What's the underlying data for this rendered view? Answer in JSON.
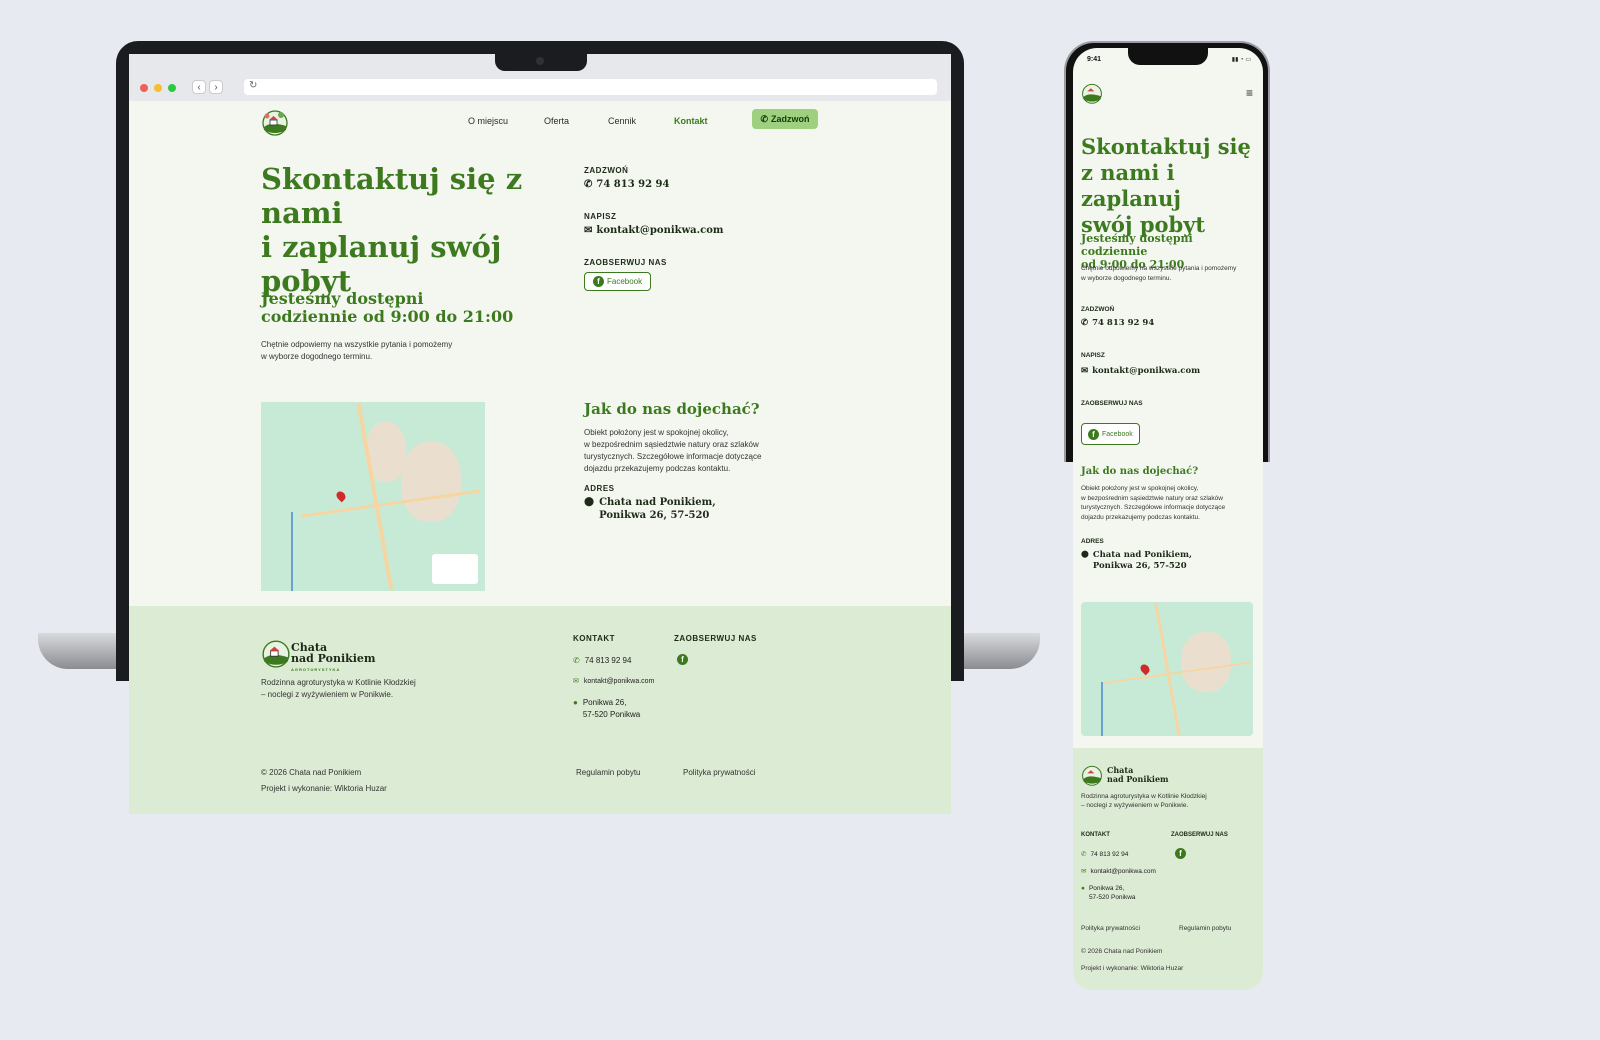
{
  "desktop": {
    "nav": {
      "items": [
        "O miejscu",
        "Oferta",
        "Cennik",
        "Kontakt"
      ],
      "call_button": "Zadzwoń"
    },
    "hero": {
      "title_line1": "Skontaktuj się z nami",
      "title_line2": "i zaplanuj swój pobyt",
      "hours_line1": "Jesteśmy dostępni",
      "hours_line2": "codziennie od 9:00 do 21:00",
      "text_line1": "Chętnie odpowiemy na wszystkie pytania i pomożemy",
      "text_line2": "w wyborze dogodnego terminu."
    },
    "contact": {
      "call_label": "ZADZWOŃ",
      "phone": "74 813 92 94",
      "write_label": "NAPISZ",
      "email": "kontakt@ponikwa.com",
      "follow_label": "ZAOBSERWUJ NAS",
      "facebook": "Facebook"
    },
    "directions": {
      "title": "Jak do nas dojechać?",
      "text_line1": "Obiekt położony jest w spokojnej okolicy,",
      "text_line2": "w bezpośrednim sąsiedztwie natury oraz szlaków",
      "text_line3": "turystycznych. Szczegółowe informacje dotyczące",
      "text_line4": "dojazdu przekazujemy podczas kontaktu.",
      "address_label": "ADRES",
      "address_line1": "Chata nad Ponikiem,",
      "address_line2": "Ponikwa 26, 57-520"
    },
    "footer": {
      "brand_line1": "Chata",
      "brand_line2": "nad Ponikiem",
      "brand_sub": "AGROTURYSTYKA",
      "desc_line1": "Rodzinna agroturystyka w Kotlinie Kłodzkiej",
      "desc_line2": "– noclegi z wyżywieniem w Ponikwie.",
      "contact_label": "KONTAKT",
      "follow_label": "ZAOBSERWUJ NAS",
      "phone": "74 813 92 94",
      "email": "kontakt@ponikwa.com",
      "addr_line1": "Ponikwa 26,",
      "addr_line2": "57-520 Ponikwa",
      "copyright": "© 2026 Chata nad Ponikiem",
      "credit": "Projekt i wykonanie: Wiktoria Huzar",
      "terms": "Regulamin pobytu",
      "privacy": "Polityka prywatności"
    }
  },
  "mobile": {
    "time": "9:41",
    "title_line1": "Skontaktuj się",
    "title_line2": "z nami i zaplanuj",
    "title_line3": "swój pobyt",
    "hours_line1": "Jesteśmy dostępni codziennie",
    "hours_line2": "od 9:00 do 21:00",
    "text_line1": "Chętnie odpowiemy na wszystkie pytania i pomożemy",
    "text_line2": "w wyborze dogodnego terminu.",
    "call_label": "ZADZWOŃ",
    "phone": "74 813 92 94",
    "write_label": "NAPISZ",
    "email": "kontakt@ponikwa.com",
    "follow_label": "ZAOBSERWUJ NAS",
    "facebook": "Facebook",
    "directions_title": "Jak do nas dojechać?",
    "dir_line1": "Obiekt położony jest w spokojnej okolicy,",
    "dir_line2": "w bezpośrednim sąsiedztwie natury oraz szlaków",
    "dir_line3": "turystycznych. Szczegółowe informacje dotyczące",
    "dir_line4": "dojazdu przekazujemy podczas kontaktu.",
    "address_label": "ADRES",
    "address_line1": "Chata nad Ponikiem,",
    "address_line2": "Ponikwa 26, 57-520",
    "footer": {
      "brand_line1": "Chata",
      "brand_line2": "nad Ponikiem",
      "desc_line1": "Rodzinna agroturystyka w Kotlinie Kłodzkiej",
      "desc_line2": "– noclegi z wyżywieniem w Ponikwie.",
      "contact_label": "KONTAKT",
      "follow_label": "ZAOBSERWUJ NAS",
      "phone": "74 813 92 94",
      "email": "kontakt@ponikwa.com",
      "addr_line1": "Ponikwa 26,",
      "addr_line2": "57-520 Ponikwa",
      "privacy": "Polityka prywatności",
      "terms": "Regulamin pobytu",
      "copyright": "© 2026 Chata nad Ponikiem",
      "credit": "Projekt i wykonanie: Wiktoria Huzar"
    }
  },
  "colors": {
    "accent_green": "#3d7a1f",
    "call_button_bg": "#9ed07f",
    "page_bg": "#f3f7f0",
    "footer_bg": "#dcebd3",
    "canvas_bg": "#e8eaf1"
  }
}
